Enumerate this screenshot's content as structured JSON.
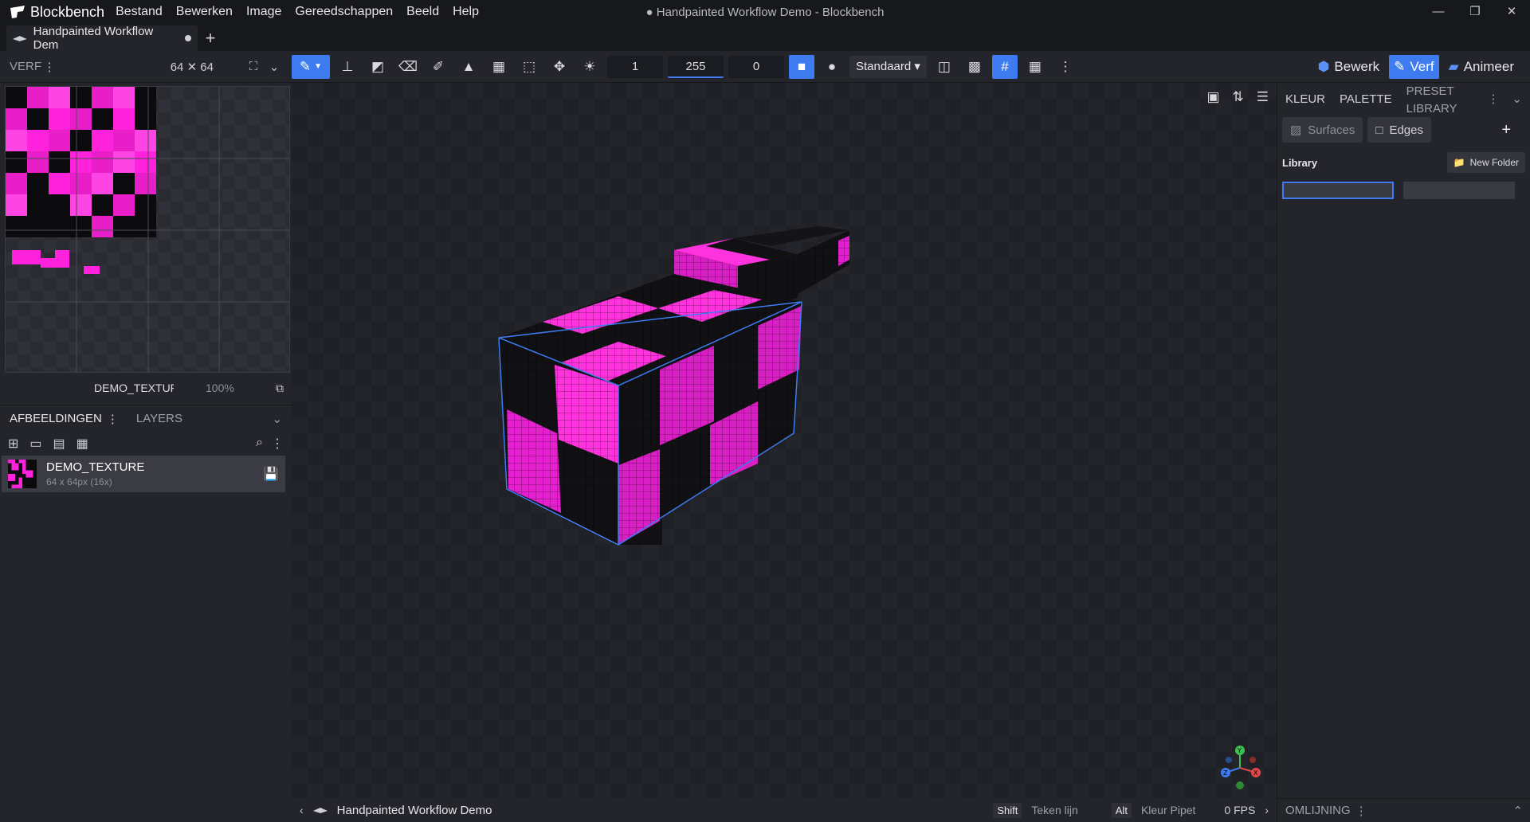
{
  "app": {
    "brand": "Blockbench",
    "menu": [
      "Bestand",
      "Bewerken",
      "Image",
      "Gereedschappen",
      "Beeld",
      "Help"
    ],
    "window_title": "● Handpainted Workflow Demo - Blockbench",
    "controls": [
      "—",
      "❐",
      "✕"
    ]
  },
  "tabs": [
    {
      "label": "Handpainted Workflow Dem"
    }
  ],
  "tab_add": "+",
  "toolbar": {
    "panel_label": "VERF",
    "canvas_size": "64 ✕ 64",
    "brush_size": "1",
    "opacity": "255",
    "softness": "0",
    "blend_mode": "Standaard ▾"
  },
  "modes": [
    {
      "label": "Bewerk",
      "icon": "cube-icon"
    },
    {
      "label": "Verf",
      "icon": "brush-icon"
    },
    {
      "label": "Animeer",
      "icon": "clapper-icon"
    }
  ],
  "uv_editor": {
    "texture_name": "DEMO_TEXTUF",
    "zoom": "100%"
  },
  "textures_panel": {
    "tab_images": "AFBEELDINGEN",
    "tab_layers": "LAYERS",
    "items": [
      {
        "name": "DEMO_TEXTURE",
        "meta": "64 x 64px (16x)"
      }
    ]
  },
  "right_panel": {
    "tabs": [
      "KLEUR",
      "PALETTE",
      "PRESET LIBRARY"
    ],
    "surfaces": "Surfaces",
    "edges": "Edges",
    "add": "+",
    "library_title": "Library",
    "new_folder": "New Folder",
    "outline": "OMLIJNING"
  },
  "status": {
    "project": "Handpainted Workflow Demo",
    "shift_key": "Shift",
    "shift_hint": "Teken lijn",
    "alt_key": "Alt",
    "alt_hint": "Kleur Pipet",
    "fps": "0 FPS"
  },
  "colors": {
    "accent": "#3e7bf0",
    "magenta": "#ff22dd",
    "dark_cell": "#0b0b0d"
  }
}
